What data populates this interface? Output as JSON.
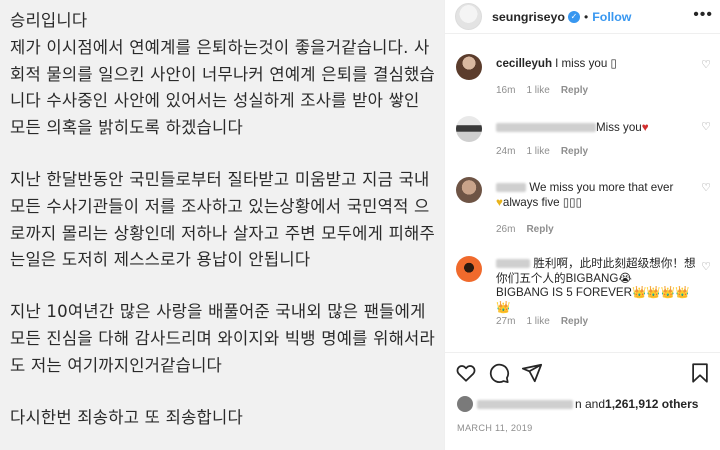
{
  "post": {
    "paragraphs": [
      "승리입니다\n제가 이시점에서 연예계를 은퇴하는것이 좋을거같습니다. 사회적 물의를 일으킨 사안이 너무나커 연예계 은퇴를 결심했습니다 수사중인 사안에 있어서는 성실하게 조사를 받아 쌓인 모든 의혹을 밝히도록 하겠습니다",
      "지난 한달반동안 국민들로부터 질타받고 미움받고 지금 국내 모든 수사기관들이 저를 조사하고 있는상황에서 국민역적 으로까지 몰리는 상황인데 저하나 살자고 주변 모두에게 피해주는일은 도저히 제스스로가 용납이 안됩니다",
      "지난 10여년간 많은 사랑을 배풀어준 국내외 많은 팬들에게 모든 진심을 다해 감사드리며   와이지와 빅뱅 명예를 위해서라도 저는 여기까지인거같습니다",
      "다시한번 죄송하고 또 죄송합니다"
    ]
  },
  "header": {
    "username": "seungriseyo",
    "verified_mark": "✓",
    "separator": "•",
    "follow_label": "Follow",
    "more_icon": "•••"
  },
  "comments": [
    {
      "user": "cecilleyuh",
      "text": "I miss you ",
      "emoji_box": "▯",
      "time": "16m",
      "likes": "1 like",
      "reply": "Reply",
      "avatar_color": "#6b4a3a"
    },
    {
      "user": "",
      "text": "Miss you",
      "heart": "♥",
      "time": "24m",
      "likes": "1 like",
      "reply": "Reply",
      "avatar_color": "#3b3b3b"
    },
    {
      "user": "",
      "text": "We miss you more that ever ",
      "text2_heart": "♥",
      "text2": "always five ",
      "emoji_boxes": "▯▯▯",
      "time": "26m",
      "reply": "Reply",
      "avatar_color": "#8a6d5a"
    },
    {
      "user": "",
      "text": "胜利啊，此时此刻超级想你！想你们五个人的BIGBANG",
      "emoji1": "😭",
      "text2": "BIGBANG IS 5 FOREVER",
      "crowns": "👑👑👑👑👑",
      "time": "27m",
      "likes": "1 like",
      "reply": "Reply",
      "avatar_color": "#e8552a"
    }
  ],
  "likes": {
    "middle": "n and ",
    "count": "1,261,912 others"
  },
  "date": "MARCH 11, 2019",
  "icons": {
    "heart": "heart-icon",
    "comment": "comment-icon",
    "share": "share-icon",
    "bookmark": "bookmark-icon"
  }
}
